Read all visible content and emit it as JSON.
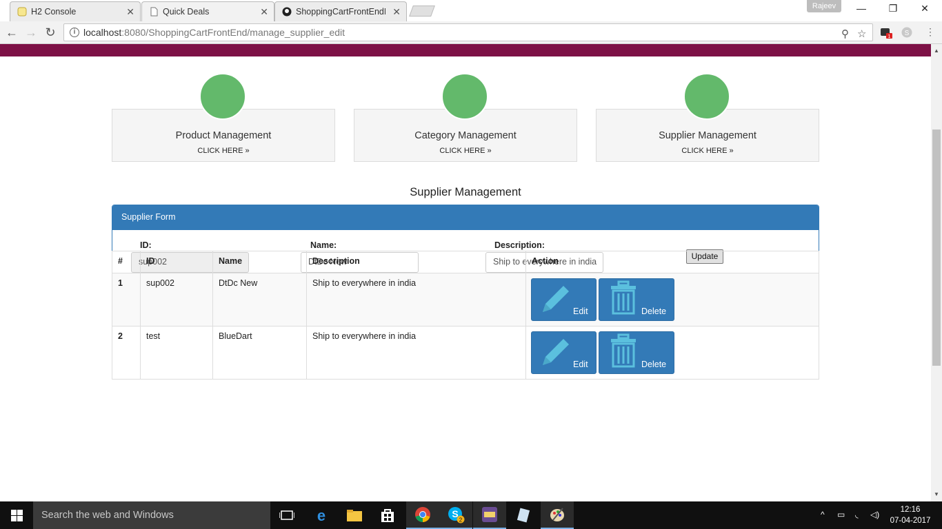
{
  "browser": {
    "tabs": [
      {
        "title": "H2 Console",
        "active": false
      },
      {
        "title": "Quick Deals",
        "active": true
      },
      {
        "title": "ShoppingCartFrontEndM",
        "active": false
      }
    ],
    "user_badge": "Rajeev",
    "url_host": "localhost",
    "url_path": ":8080/ShoppingCartFrontEnd/manage_supplier_edit",
    "extension_badge": "1"
  },
  "colors": {
    "brand_bar": "#7d1146",
    "accent": "#337ab7",
    "circle": "#63b96b"
  },
  "management_cards": [
    {
      "title": "Product Management",
      "link": "CLICK HERE »"
    },
    {
      "title": "Category Management",
      "link": "CLICK HERE »"
    },
    {
      "title": "Supplier Management",
      "link": "CLICK HERE »"
    }
  ],
  "section_title": "Supplier Management",
  "form": {
    "heading": "Supplier Form",
    "id_label": "ID:",
    "id_value": "sup002",
    "name_label": "Name:",
    "name_value": "DtDc New",
    "description_label": "Description:",
    "description_value": "Ship to everywhere in india",
    "submit_label": "Update"
  },
  "table": {
    "headers": [
      "#",
      "ID",
      "Name",
      "Description",
      "Action"
    ],
    "rows": [
      {
        "num": "1",
        "id": "sup002",
        "name": "DtDc New",
        "description": "Ship to everywhere in india"
      },
      {
        "num": "2",
        "id": "test",
        "name": "BlueDart",
        "description": "Ship to everywhere in india"
      }
    ],
    "edit_label": "Edit",
    "delete_label": "Delete"
  },
  "taskbar": {
    "search_placeholder": "Search the web and Windows",
    "time": "12:16",
    "date": "07-04-2017",
    "skype_badge": "2"
  }
}
